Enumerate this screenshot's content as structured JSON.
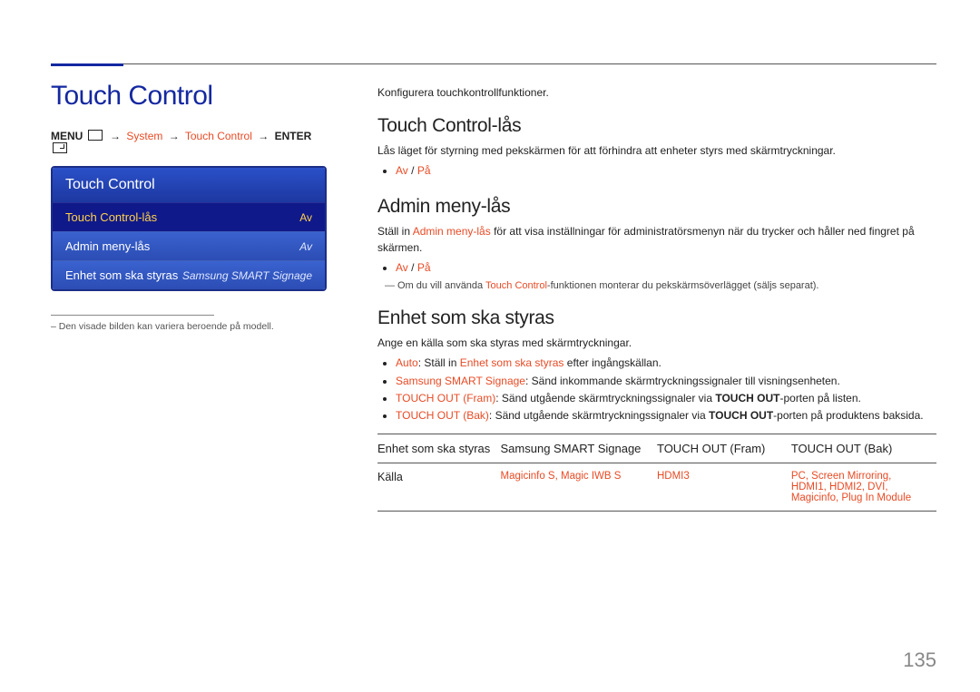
{
  "page_title": "Touch Control",
  "menu_path": {
    "prefix": "MENU",
    "system": "System",
    "touch_control": "Touch Control",
    "enter": "ENTER"
  },
  "osd": {
    "title": "Touch Control",
    "rows": [
      {
        "label": "Touch Control-lås",
        "value": "Av",
        "selected": true
      },
      {
        "label": "Admin meny-lås",
        "value": "Av",
        "selected": false
      },
      {
        "label": "Enhet som ska styras",
        "value": "Samsung SMART Signage",
        "selected": false
      }
    ]
  },
  "footnote": "– Den visade bilden kan variera beroende på modell.",
  "intro": "Konfigurera touchkontrollfunktioner.",
  "sec1": {
    "heading": "Touch Control-lås",
    "body": "Lås läget för styrning med pekskärmen för att förhindra att enheter styrs med skärmtryckningar.",
    "opt_av": "Av",
    "opt_pa": "På",
    "sep": " / "
  },
  "sec2": {
    "heading": "Admin meny-lås",
    "body_pre": "Ställ in ",
    "body_admin": "Admin meny-lås",
    "body_post": " för att visa inställningar för administratörsmenyn när du trycker och håller ned fingret på skärmen.",
    "opt_av": "Av",
    "opt_pa": "På",
    "sep": " / ",
    "note_pre": "Om du vill använda ",
    "note_tc": "Touch Control",
    "note_post": "-funktionen monterar du pekskärmsöverlägget (säljs separat)."
  },
  "sec3": {
    "heading": "Enhet som ska styras",
    "body": "Ange en källa som ska styras med skärmtryckningar.",
    "bullets": [
      {
        "lead": "Auto",
        "mid": ": Ställ in ",
        "em": "Enhet som ska styras",
        "post": " efter ingångskällan."
      },
      {
        "lead": "Samsung SMART Signage",
        "post": ": Sänd inkommande skärmtryckningssignaler till visningsenheten."
      },
      {
        "lead": "TOUCH OUT (Fram)",
        "mid": ": Sänd utgående skärmtryckningssignaler via ",
        "strong": "TOUCH OUT",
        "post": "-porten på listen."
      },
      {
        "lead": "TOUCH OUT (Bak)",
        "mid": ": Sänd utgående skärmtryckningssignaler via ",
        "strong": "TOUCH OUT",
        "post": "-porten på produktens baksida."
      }
    ]
  },
  "table": {
    "headers": [
      "Enhet som ska styras",
      "Samsung SMART Signage",
      "TOUCH OUT (Fram)",
      "TOUCH OUT (Bak)"
    ],
    "row_label": "Källa",
    "cells": [
      "Magicinfo S, Magic IWB S",
      "HDMI3",
      "PC, Screen Mirroring, HDMI1, HDMI2, DVI, Magicinfo, Plug In Module"
    ]
  },
  "page_number": "135"
}
